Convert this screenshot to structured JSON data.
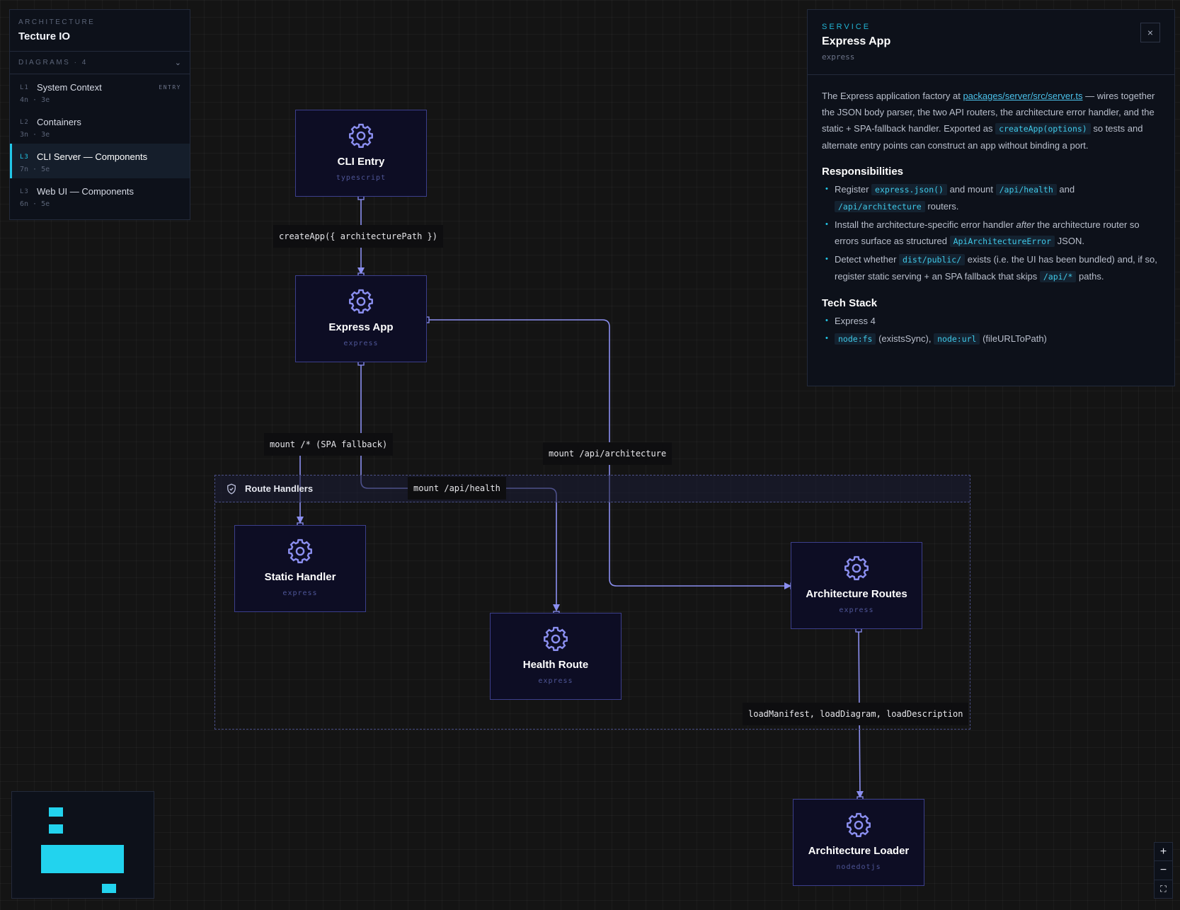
{
  "nav": {
    "kicker": "ARCHITECTURE",
    "title": "Tecture IO",
    "diagrams_header": "DIAGRAMS · 4",
    "items": [
      {
        "level": "L1",
        "name": "System Context",
        "badge": "ENTRY",
        "meta": "4n · 3e",
        "active": false
      },
      {
        "level": "L2",
        "name": "Containers",
        "badge": "",
        "meta": "3n · 3e",
        "active": false
      },
      {
        "level": "L3",
        "name": "CLI Server — Components",
        "badge": "",
        "meta": "7n · 5e",
        "active": true
      },
      {
        "level": "L3",
        "name": "Web UI — Components",
        "badge": "",
        "meta": "6n · 5e",
        "active": false
      }
    ]
  },
  "diagram": {
    "group": {
      "name": "Route Handlers",
      "icon": "shield-icon"
    },
    "nodes": {
      "cli_entry": {
        "name": "CLI Entry",
        "tech": "typescript",
        "icon": "gear-icon"
      },
      "express_app": {
        "name": "Express App",
        "tech": "express",
        "icon": "gear-icon"
      },
      "static_handler": {
        "name": "Static Handler",
        "tech": "express",
        "icon": "gear-icon"
      },
      "health_route": {
        "name": "Health Route",
        "tech": "express",
        "icon": "gear-icon"
      },
      "architecture_routes": {
        "name": "Architecture Routes",
        "tech": "express",
        "icon": "gear-icon"
      },
      "architecture_loader": {
        "name": "Architecture Loader",
        "tech": "nodedotjs",
        "icon": "gear-icon"
      }
    },
    "edges": {
      "create_app": "createApp({ architecturePath })",
      "mount_spa": "mount /* (SPA fallback)",
      "mount_health": "mount /api/health",
      "mount_architecture": "mount /api/architecture",
      "load_calls": "loadManifest, loadDiagram, loadDescription"
    }
  },
  "detail": {
    "kicker": "SERVICE",
    "title": "Express App",
    "tech": "express",
    "close_label": "×",
    "intro": {
      "t1": "The Express application factory at ",
      "link": "packages/server/src/server.ts",
      "t2": " — wires together the JSON body parser, the two API routers, the architecture error handler, and the static + SPA-fallback handler. Exported as ",
      "code": "createApp(options)",
      "t3": " so tests and alternate entry points can construct an app without binding a port."
    },
    "responsibilities_title": "Responsibilities",
    "responsibilities": {
      "r1": {
        "t1": "Register ",
        "c1": "express.json()",
        "t2": " and mount ",
        "c2": "/api/health",
        "t3": " and ",
        "c3": "/api/architecture",
        "t4": " routers."
      },
      "r2": {
        "t1": "Install the architecture-specific error handler ",
        "em": "after",
        "t2": " the architecture router so errors surface as structured ",
        "c1": "ApiArchitectureError",
        "t3": " JSON."
      },
      "r3": {
        "t1": "Detect whether ",
        "c1": "dist/public/",
        "t2": " exists (i.e. the UI has been bundled) and, if so, register static serving + an SPA fallback that skips ",
        "c2": "/api/*",
        "t3": " paths."
      }
    },
    "techstack_title": "Tech Stack",
    "techstack": {
      "s1": "Express 4",
      "s2": {
        "c1": "node:fs",
        "t1": " (existsSync), ",
        "c2": "node:url",
        "t2": " (fileURLToPath)"
      }
    }
  },
  "zoom": {
    "in": "+",
    "out": "−",
    "fit": "⛶"
  },
  "colors": {
    "accent": "#22c7e8",
    "edge": "#8b8ff0",
    "node_border": "#3c3f8c",
    "minimap": "#22d3ee"
  }
}
